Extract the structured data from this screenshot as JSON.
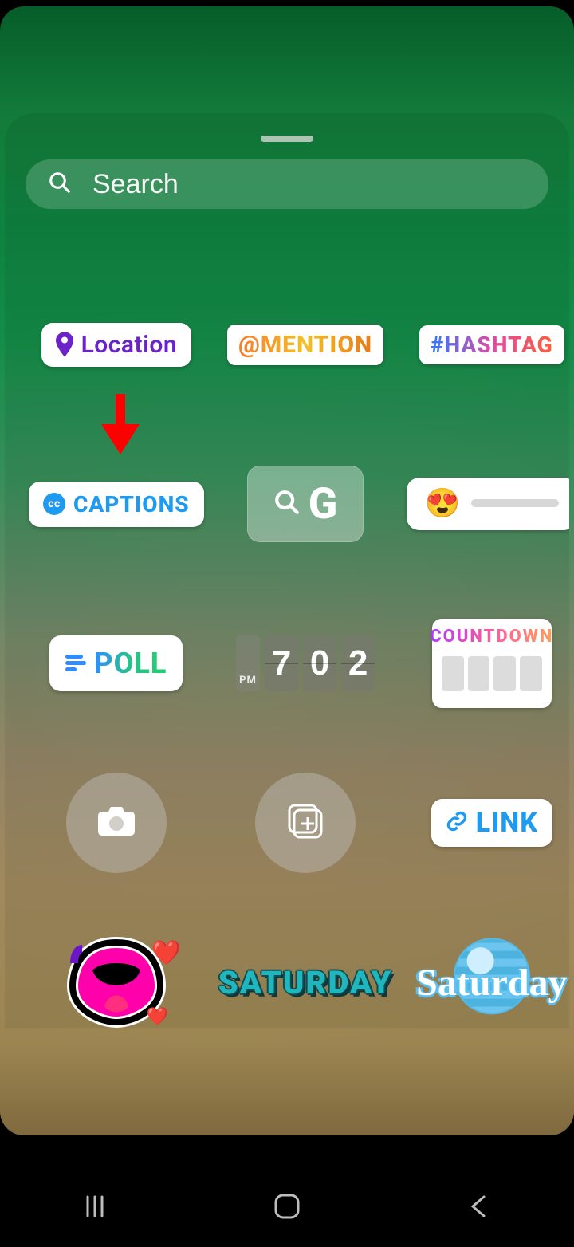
{
  "search": {
    "placeholder": "Search"
  },
  "stickers": {
    "location": "Location",
    "mention": "@MENTION",
    "hashtag": "#HASHTAG",
    "cc_badge": "cc",
    "captions": "CAPTIONS",
    "gif_letter": "G",
    "emoji": "😍",
    "poll": "POLL",
    "countdown": "COUNTDOWN",
    "link": "LINK",
    "day_upper": "SATURDAY",
    "day_script": "Saturday"
  },
  "time": {
    "ampm": "PM",
    "hour": "7",
    "min_tens": "0",
    "min_ones": "2"
  }
}
